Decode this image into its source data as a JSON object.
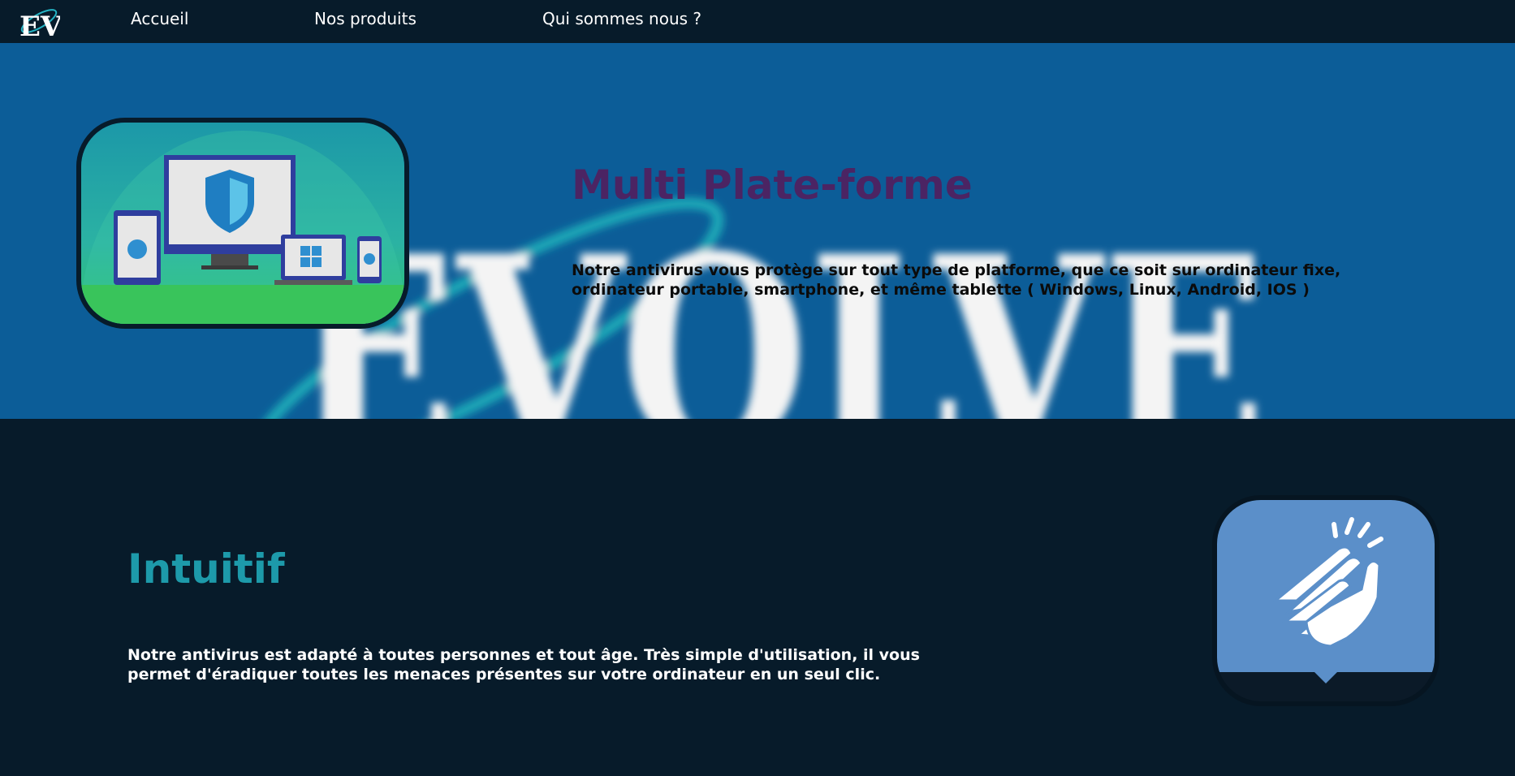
{
  "nav": {
    "logo_text": "EV",
    "links": [
      "Accueil",
      "Nos produits",
      "Qui sommes nous ?"
    ]
  },
  "hero": {
    "background_word": "EVOLVE",
    "title": "Multi Plate-forme",
    "text": "Notre antivirus vous protège sur tout type de platforme, que ce soit sur ordinateur fixe, ordinateur portable, smartphone, et même tablette ( Windows, Linux, Android, IOS )"
  },
  "section2": {
    "title": "Intuitif",
    "text": "Notre antivirus est adapté à toutes personnes et tout âge. Très simple d'utilisation, il vous permet d'éradiquer toutes les menaces présentes sur votre ordinateur en un seul clic."
  },
  "icons": {
    "hero_image": "multi-device-shield-icon",
    "section2_image": "finger-snap-icon"
  },
  "colors": {
    "navbar": "#071b2a",
    "hero_bg": "#0c5d98",
    "hero_title": "#4b2463",
    "intuitif_title": "#1d9aaa",
    "click_card": "#5b8fc9"
  }
}
